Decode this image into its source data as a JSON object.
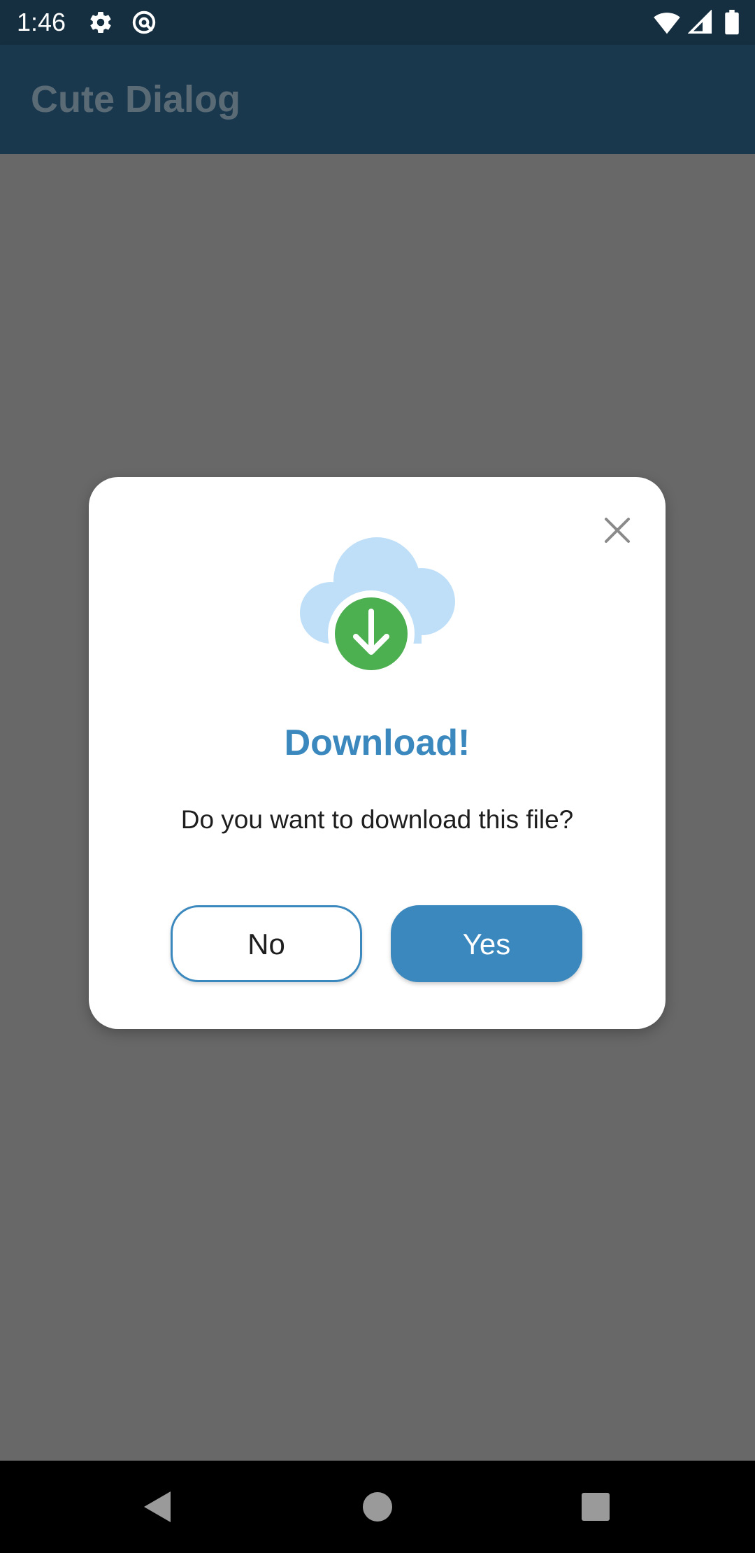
{
  "status_bar": {
    "time": "1:46",
    "icons": [
      "gear-icon",
      "at-sign-icon",
      "wifi-icon",
      "cell-signal-icon",
      "battery-icon"
    ]
  },
  "app_bar": {
    "title": "Cute Dialog"
  },
  "dialog": {
    "icon": "cloud-download-icon",
    "title": "Download!",
    "message": "Do you want to download this file?",
    "no_label": "No",
    "yes_label": "Yes",
    "close_icon": "close-icon"
  },
  "nav_bar": {
    "icons": [
      "back-icon",
      "home-icon",
      "recents-icon"
    ]
  },
  "colors": {
    "status_bar": "#162f40",
    "app_bar": "#19384e",
    "scrim": "#686868",
    "accent": "#3a88bd",
    "cloud": "#bfdff8",
    "download_circle": "#4caf50"
  }
}
